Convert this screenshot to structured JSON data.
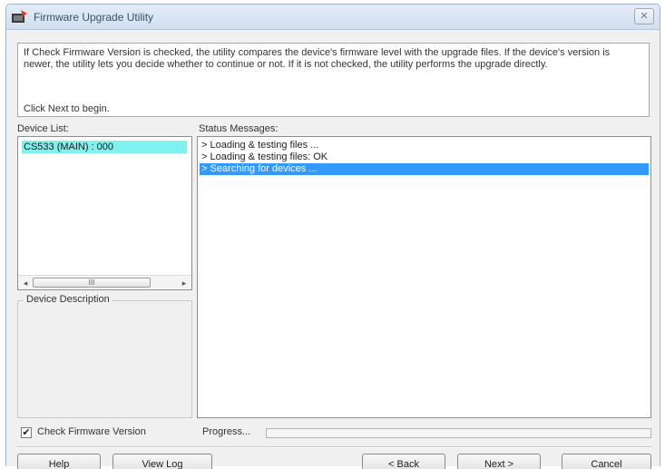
{
  "window": {
    "title": "Firmware Upgrade Utility",
    "close_glyph": "✕"
  },
  "info": {
    "text": "If Check Firmware Version is checked, the utility compares the device's firmware level with the upgrade files. If the device's version is newer, the utility lets you decide whether to continue or not. If it is not checked, the utility performs the upgrade directly.",
    "click_next": "Click Next to begin."
  },
  "device_list": {
    "label": "Device List:",
    "items": [
      "CS533 (MAIN) : 000"
    ],
    "scroll_thumb": "III"
  },
  "device_description": {
    "label": "Device Description"
  },
  "status": {
    "label": "Status Messages:",
    "lines": [
      "> Loading & testing files ...",
      "> Loading & testing files: OK",
      "> Searching for devices ..."
    ],
    "selected_index": 2
  },
  "check_firmware": {
    "label": "Check Firmware Version",
    "checked": true,
    "check_glyph": "✔"
  },
  "progress": {
    "label": "Progress...",
    "value": 0.0
  },
  "buttons": {
    "help": "Help",
    "view_log": "View Log",
    "back": "< Back",
    "next": "Next >",
    "cancel": "Cancel"
  },
  "colors": {
    "device_highlight": "#7ff2f0",
    "status_selected": "#3399ff"
  },
  "icons": {
    "app": "firmware-app-icon",
    "close": "close-icon",
    "scroll_left": "arrow-left-icon",
    "scroll_right": "arrow-right-icon"
  }
}
